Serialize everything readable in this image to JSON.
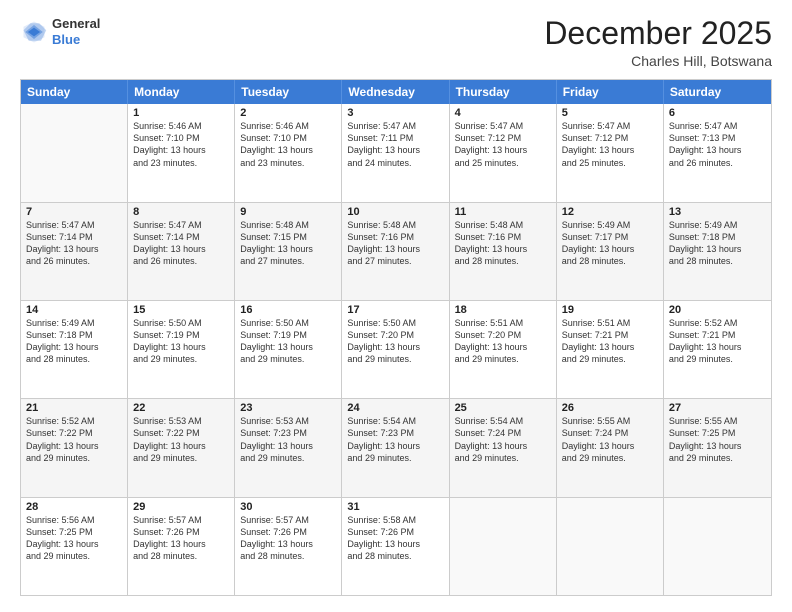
{
  "logo": {
    "general": "General",
    "blue": "Blue"
  },
  "title": "December 2025",
  "subtitle": "Charles Hill, Botswana",
  "header_days": [
    "Sunday",
    "Monday",
    "Tuesday",
    "Wednesday",
    "Thursday",
    "Friday",
    "Saturday"
  ],
  "rows": [
    [
      {
        "day": "",
        "empty": true
      },
      {
        "day": "1",
        "rise": "5:46 AM",
        "set": "7:10 PM",
        "daylight": "13 hours and 23 minutes."
      },
      {
        "day": "2",
        "rise": "5:46 AM",
        "set": "7:10 PM",
        "daylight": "13 hours and 23 minutes."
      },
      {
        "day": "3",
        "rise": "5:47 AM",
        "set": "7:11 PM",
        "daylight": "13 hours and 24 minutes."
      },
      {
        "day": "4",
        "rise": "5:47 AM",
        "set": "7:12 PM",
        "daylight": "13 hours and 25 minutes."
      },
      {
        "day": "5",
        "rise": "5:47 AM",
        "set": "7:12 PM",
        "daylight": "13 hours and 25 minutes."
      },
      {
        "day": "6",
        "rise": "5:47 AM",
        "set": "7:13 PM",
        "daylight": "13 hours and 26 minutes."
      }
    ],
    [
      {
        "day": "7",
        "rise": "5:47 AM",
        "set": "7:14 PM",
        "daylight": "13 hours and 26 minutes."
      },
      {
        "day": "8",
        "rise": "5:47 AM",
        "set": "7:14 PM",
        "daylight": "13 hours and 26 minutes."
      },
      {
        "day": "9",
        "rise": "5:48 AM",
        "set": "7:15 PM",
        "daylight": "13 hours and 27 minutes."
      },
      {
        "day": "10",
        "rise": "5:48 AM",
        "set": "7:16 PM",
        "daylight": "13 hours and 27 minutes."
      },
      {
        "day": "11",
        "rise": "5:48 AM",
        "set": "7:16 PM",
        "daylight": "13 hours and 28 minutes."
      },
      {
        "day": "12",
        "rise": "5:49 AM",
        "set": "7:17 PM",
        "daylight": "13 hours and 28 minutes."
      },
      {
        "day": "13",
        "rise": "5:49 AM",
        "set": "7:18 PM",
        "daylight": "13 hours and 28 minutes."
      }
    ],
    [
      {
        "day": "14",
        "rise": "5:49 AM",
        "set": "7:18 PM",
        "daylight": "13 hours and 28 minutes."
      },
      {
        "day": "15",
        "rise": "5:50 AM",
        "set": "7:19 PM",
        "daylight": "13 hours and 29 minutes."
      },
      {
        "day": "16",
        "rise": "5:50 AM",
        "set": "7:19 PM",
        "daylight": "13 hours and 29 minutes."
      },
      {
        "day": "17",
        "rise": "5:50 AM",
        "set": "7:20 PM",
        "daylight": "13 hours and 29 minutes."
      },
      {
        "day": "18",
        "rise": "5:51 AM",
        "set": "7:20 PM",
        "daylight": "13 hours and 29 minutes."
      },
      {
        "day": "19",
        "rise": "5:51 AM",
        "set": "7:21 PM",
        "daylight": "13 hours and 29 minutes."
      },
      {
        "day": "20",
        "rise": "5:52 AM",
        "set": "7:21 PM",
        "daylight": "13 hours and 29 minutes."
      }
    ],
    [
      {
        "day": "21",
        "rise": "5:52 AM",
        "set": "7:22 PM",
        "daylight": "13 hours and 29 minutes."
      },
      {
        "day": "22",
        "rise": "5:53 AM",
        "set": "7:22 PM",
        "daylight": "13 hours and 29 minutes."
      },
      {
        "day": "23",
        "rise": "5:53 AM",
        "set": "7:23 PM",
        "daylight": "13 hours and 29 minutes."
      },
      {
        "day": "24",
        "rise": "5:54 AM",
        "set": "7:23 PM",
        "daylight": "13 hours and 29 minutes."
      },
      {
        "day": "25",
        "rise": "5:54 AM",
        "set": "7:24 PM",
        "daylight": "13 hours and 29 minutes."
      },
      {
        "day": "26",
        "rise": "5:55 AM",
        "set": "7:24 PM",
        "daylight": "13 hours and 29 minutes."
      },
      {
        "day": "27",
        "rise": "5:55 AM",
        "set": "7:25 PM",
        "daylight": "13 hours and 29 minutes."
      }
    ],
    [
      {
        "day": "28",
        "rise": "5:56 AM",
        "set": "7:25 PM",
        "daylight": "13 hours and 29 minutes."
      },
      {
        "day": "29",
        "rise": "5:57 AM",
        "set": "7:26 PM",
        "daylight": "13 hours and 28 minutes."
      },
      {
        "day": "30",
        "rise": "5:57 AM",
        "set": "7:26 PM",
        "daylight": "13 hours and 28 minutes."
      },
      {
        "day": "31",
        "rise": "5:58 AM",
        "set": "7:26 PM",
        "daylight": "13 hours and 28 minutes."
      },
      {
        "day": "",
        "empty": true
      },
      {
        "day": "",
        "empty": true
      },
      {
        "day": "",
        "empty": true
      }
    ]
  ],
  "labels": {
    "sunrise": "Sunrise:",
    "sunset": "Sunset:",
    "daylight": "Daylight:"
  }
}
